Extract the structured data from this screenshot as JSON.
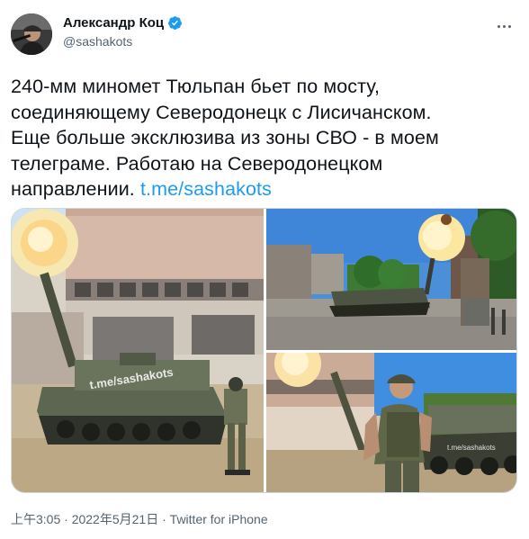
{
  "author": {
    "name": "Александр Коц",
    "handle": "@sashakots",
    "verified": true
  },
  "tweet": {
    "text_lines": [
      "240-мм миномет Тюльпан бьет по мосту,",
      "соединяющему Северодонецк с Лисичанском.",
      "Еще больше эксклюзива из зоны СВО - в моем",
      "телеграме. Работаю на Северодонецком"
    ],
    "text_last": "направлении. ",
    "link": "t.me/sashakots"
  },
  "media": {
    "watermark": "t.me/sashakots",
    "watermark_small": "t.me/sashakots"
  },
  "footer": {
    "time": "上午3:05",
    "sep1": " · ",
    "date": "2022年5月21日",
    "sep2": " · ",
    "source": "Twitter for iPhone"
  },
  "colors": {
    "link": "#1d9bf0",
    "secondary": "#536471",
    "verified": "#1d9bf0"
  }
}
